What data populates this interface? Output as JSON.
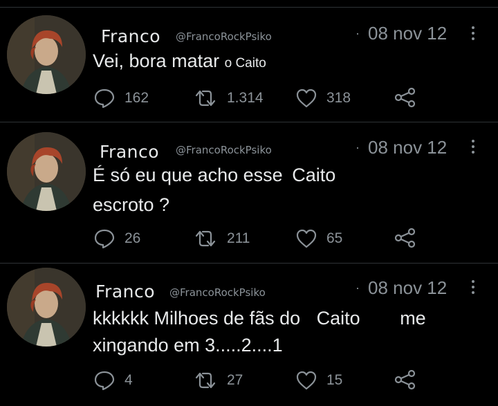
{
  "tweets": [
    {
      "name": "Franco",
      "handle": "@FrancoRockPsiko",
      "separator": "·",
      "date": "08 nov 12",
      "text_line1_a": "Vei, bora matar",
      "text_line1_b": "o Caito",
      "replies": "162",
      "retweets": "1.314",
      "likes": "318"
    },
    {
      "name": "Franco",
      "handle": "@FrancoRockPsiko",
      "separator": "·",
      "date": "08 nov 12",
      "text_line1_a": "É só eu que acho esse",
      "text_line1_b": "Caito",
      "text_line2": "escroto ?",
      "replies": "26",
      "retweets": "211",
      "likes": "65"
    },
    {
      "name": "Franco",
      "handle": "@FrancoRockPsiko",
      "separator": "·",
      "date": "08 nov 12",
      "text_line1_a": "kkkkkk Milhoes de fãs do",
      "text_line1_b": "Caito",
      "text_line1_c": "me",
      "text_line2": "xingando em 3.....2....1",
      "replies": "4",
      "retweets": "27",
      "likes": "15"
    }
  ],
  "icons": {
    "avatar": "avatar-portrait",
    "more": "more-vertical-icon",
    "reply": "reply-icon",
    "retweet": "retweet-icon",
    "like": "heart-icon",
    "share": "share-icon"
  }
}
